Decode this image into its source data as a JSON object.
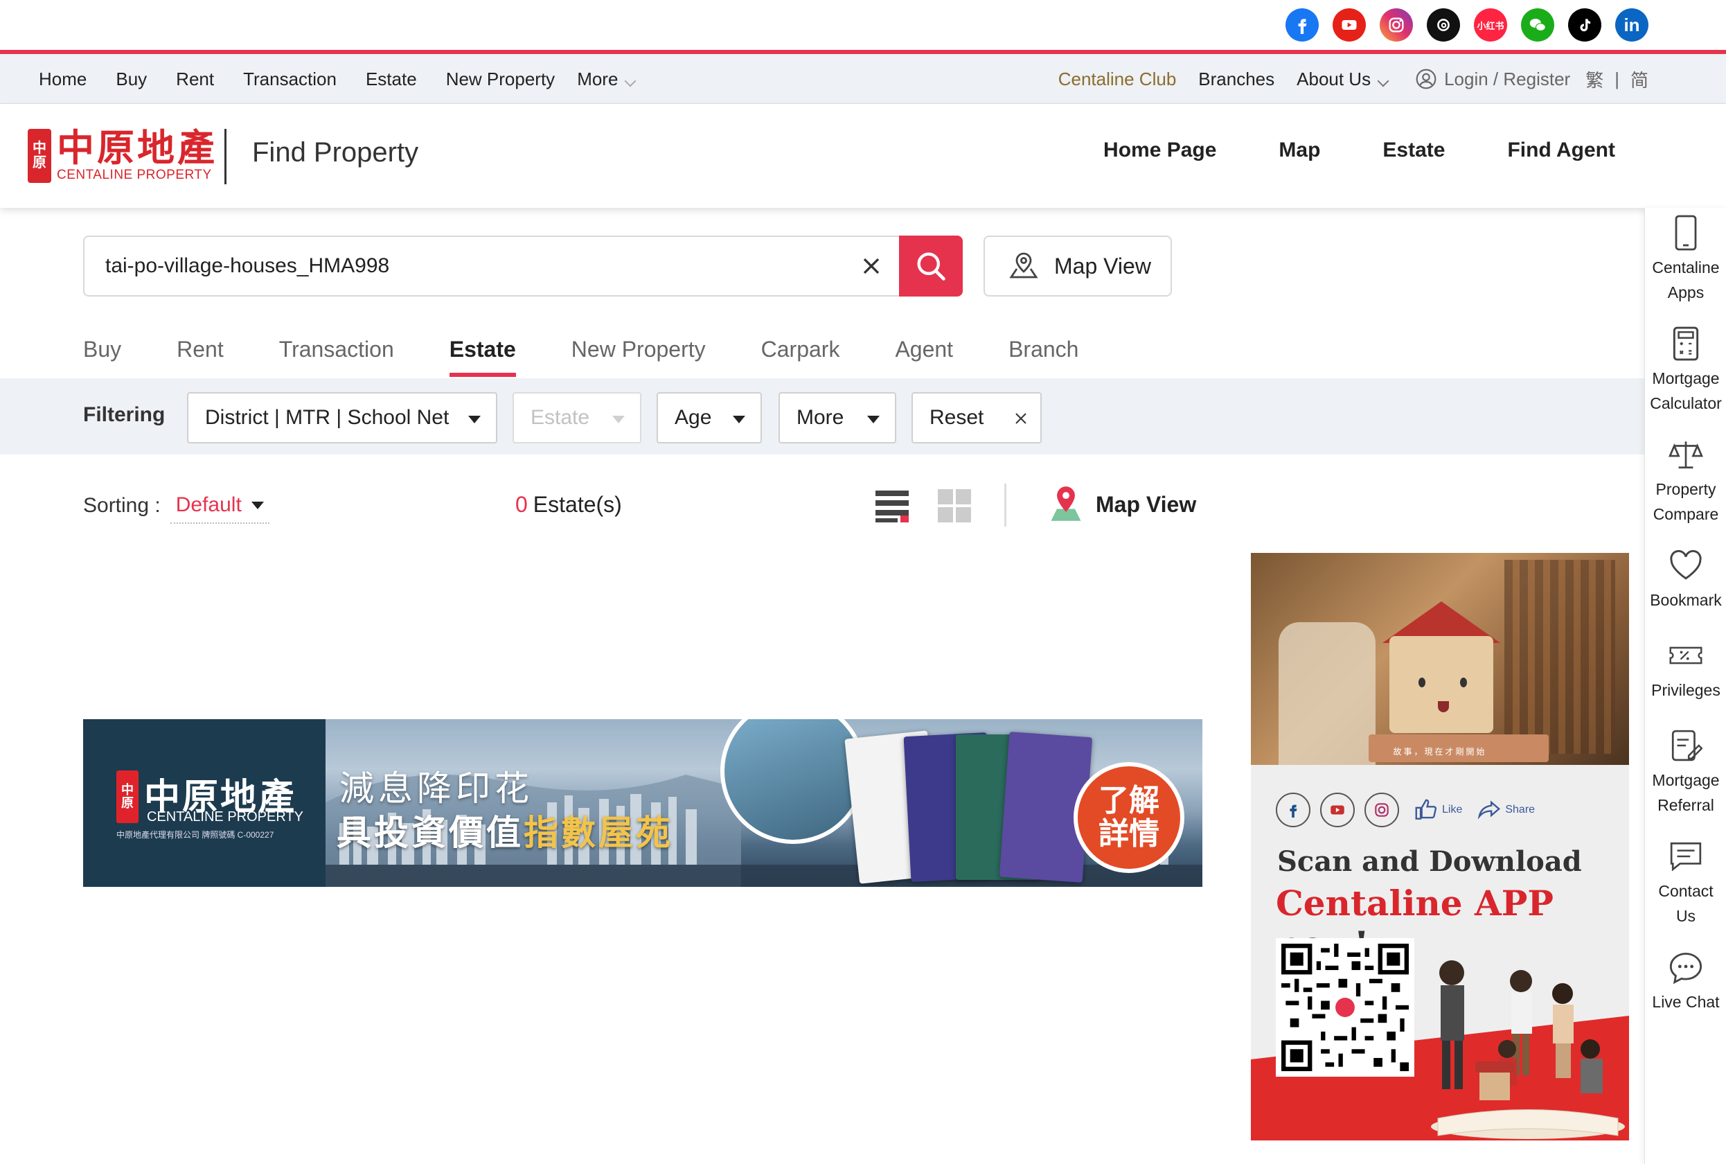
{
  "social": {
    "icons": [
      "facebook-icon",
      "youtube-icon",
      "instagram-icon",
      "threads-icon",
      "xiaohongshu-icon",
      "wechat-icon",
      "tiktok-icon",
      "linkedin-icon"
    ],
    "xiaohongshu_label": "小红书",
    "linkedin_label": "in"
  },
  "topnav": {
    "left": [
      "Home",
      "Buy",
      "Rent",
      "Transaction",
      "Estate",
      "New Property",
      "More"
    ],
    "club": "Centaline Club",
    "branches": "Branches",
    "about": "About Us",
    "login": "Login / Register",
    "lang_trad": "繁",
    "lang_sep": "|",
    "lang_simp": "简"
  },
  "header": {
    "logo_cn": "中原地產",
    "logo_en": "CENTALINE PROPERTY",
    "logo_mark_top": "中",
    "logo_mark_bottom": "原",
    "title": "Find Property",
    "nav": [
      "Home Page",
      "Map",
      "Estate",
      "Find Agent"
    ]
  },
  "search": {
    "value": "tai-po-village-houses_HMA998",
    "map_view": "Map View"
  },
  "tabs": {
    "items": [
      "Buy",
      "Rent",
      "Transaction",
      "Estate",
      "New Property",
      "Carpark",
      "Agent",
      "Branch"
    ],
    "active": "Estate"
  },
  "filter": {
    "label": "Filtering",
    "district": "District | MTR | School Net",
    "estate": "Estate",
    "age": "Age",
    "more": "More",
    "reset": "Reset"
  },
  "results": {
    "sorting_label": "Sorting :",
    "sorting_value": "Default",
    "count": "0",
    "count_label": "Estate(s)",
    "map_view": "Map View"
  },
  "sidebar": {
    "items": [
      {
        "line1": "Centaline",
        "line2": "Apps",
        "icon": "phone-icon"
      },
      {
        "line1": "Mortgage",
        "line2": "Calculator",
        "icon": "calculator-icon"
      },
      {
        "line1": "Property",
        "line2": "Compare",
        "icon": "scale-icon"
      },
      {
        "line1": "Bookmark",
        "line2": "",
        "icon": "heart-icon"
      },
      {
        "line1": "Privileges",
        "line2": "",
        "icon": "coupon-icon"
      },
      {
        "line1": "Mortgage",
        "line2": "Referral",
        "icon": "referral-icon"
      },
      {
        "line1": "Contact",
        "line2": "Us",
        "icon": "message-icon"
      },
      {
        "line1": "Live Chat",
        "line2": "",
        "icon": "chat-icon"
      }
    ]
  },
  "banner": {
    "logo_cn": "中原地產",
    "logo_en": "CENTALINE PROPERTY",
    "logo_small": "中原地產代理有限公司  牌照號碼 C-000227",
    "line1": "減息降印花",
    "line2_a": "具投資價值",
    "line2_b": "指數屋苑",
    "cta_1": "了解",
    "cta_2": "詳情"
  },
  "ad": {
    "caption": "故事，現在才剛開始",
    "like": "Like",
    "share": "Share",
    "scan": "Scan and Download",
    "app": "Centaline APP",
    "now": "now!"
  },
  "colors": {
    "accent": "#e5334e",
    "brand_red": "#d9262c",
    "club_gold": "#8a6d2c",
    "nav_bg": "#eef1f5"
  }
}
